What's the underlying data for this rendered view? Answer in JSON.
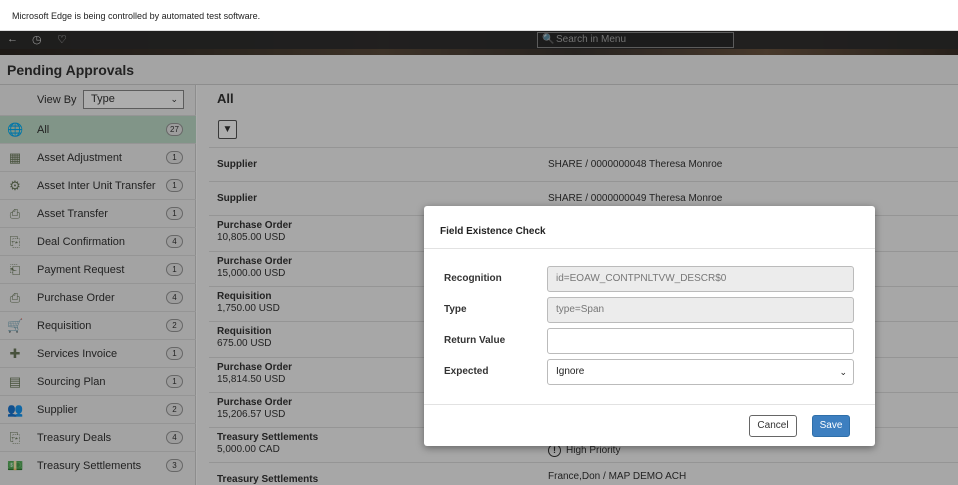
{
  "browser": {
    "infobar_text": "Microsoft Edge is being controlled by automated test software.",
    "back_glyph": "←",
    "history_glyph": "◷",
    "favorite_glyph": "♡",
    "search_placeholder": "Search in Menu",
    "search_glyph": "🔍"
  },
  "page": {
    "title": "Pending Approvals"
  },
  "sidebar": {
    "viewby_label": "View By",
    "viewby_value": "Type",
    "chevron": "⌄",
    "items": [
      {
        "label": "All",
        "count": "27",
        "icon": "globe-icon",
        "glyph": "🌐"
      },
      {
        "label": "Asset Adjustment",
        "count": "1",
        "icon": "asset-adjustment-icon",
        "glyph": "▦"
      },
      {
        "label": "Asset Inter Unit Transfer",
        "count": "1",
        "icon": "asset-transfer-unit-icon",
        "glyph": "⚙"
      },
      {
        "label": "Asset Transfer",
        "count": "1",
        "icon": "asset-transfer-icon",
        "glyph": "⎙"
      },
      {
        "label": "Deal Confirmation",
        "count": "4",
        "icon": "deal-confirmation-icon",
        "glyph": "⎘"
      },
      {
        "label": "Payment Request",
        "count": "1",
        "icon": "payment-request-icon",
        "glyph": "⎗"
      },
      {
        "label": "Purchase Order",
        "count": "4",
        "icon": "purchase-order-icon",
        "glyph": "⎙"
      },
      {
        "label": "Requisition",
        "count": "2",
        "icon": "cart-icon",
        "glyph": "🛒"
      },
      {
        "label": "Services Invoice",
        "count": "1",
        "icon": "services-invoice-icon",
        "glyph": "✚"
      },
      {
        "label": "Sourcing Plan",
        "count": "1",
        "icon": "sourcing-plan-icon",
        "glyph": "▤"
      },
      {
        "label": "Supplier",
        "count": "2",
        "icon": "supplier-icon",
        "glyph": "👥"
      },
      {
        "label": "Treasury Deals",
        "count": "4",
        "icon": "treasury-deals-icon",
        "glyph": "⎘"
      },
      {
        "label": "Treasury Settlements",
        "count": "3",
        "icon": "treasury-settlements-icon",
        "glyph": "💵"
      }
    ]
  },
  "main": {
    "heading": "All",
    "filter_glyph": "▼",
    "rows": [
      {
        "type": "Supplier",
        "amount": "",
        "right": "SHARE / 0000000048  Theresa Monroe"
      },
      {
        "type": "Supplier",
        "amount": "",
        "right": "SHARE / 0000000049  Theresa Monroe"
      },
      {
        "type": "Purchase Order",
        "amount": "10,805.00  USD",
        "right": ""
      },
      {
        "type": "Purchase Order",
        "amount": "15,000.00  USD",
        "right": ""
      },
      {
        "type": "Requisition",
        "amount": "1,750.00  USD",
        "right": ""
      },
      {
        "type": "Requisition",
        "amount": "675.00  USD",
        "right": ""
      },
      {
        "type": "Purchase Order",
        "amount": "15,814.50  USD",
        "right": ""
      },
      {
        "type": "Purchase Order",
        "amount": "15,206.57  USD",
        "right": ""
      },
      {
        "type": "Treasury Settlements",
        "amount": "5,000.00  CAD",
        "right": "High Priority"
      },
      {
        "type": "Treasury Settlements",
        "amount": "",
        "right": "France,Don / MAP DEMO ACH"
      }
    ],
    "priority_glyph": "!"
  },
  "modal": {
    "title": "Field Existence Check",
    "recognition_label": "Recognition",
    "recognition_value": "id=EOAW_CONTPNLTVW_DESCR$0",
    "type_label": "Type",
    "type_value": "type=Span",
    "return_label": "Return Value",
    "return_value": "",
    "expected_label": "Expected",
    "expected_value": "Ignore",
    "cancel_label": "Cancel",
    "save_label": "Save"
  }
}
